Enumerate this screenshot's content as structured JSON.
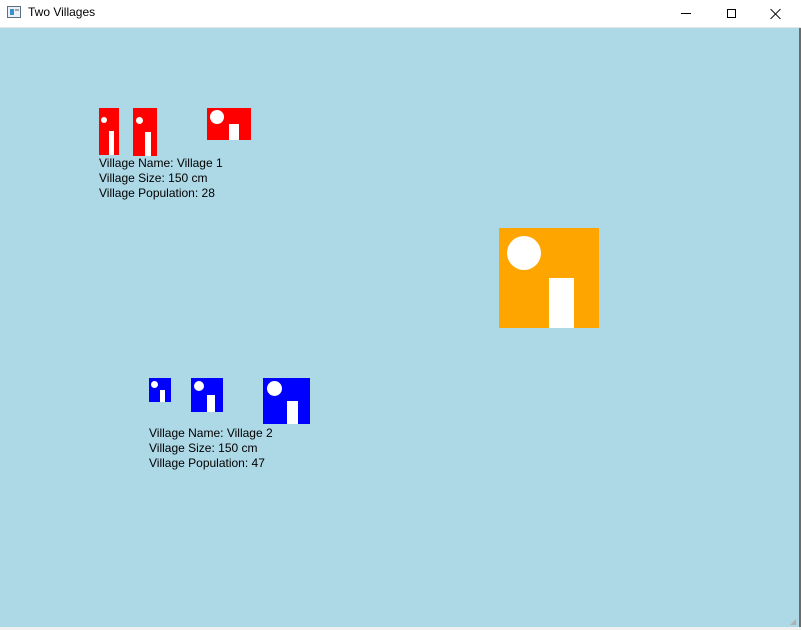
{
  "window": {
    "title": "Two Villages",
    "icon": "app-window-icon"
  },
  "colors": {
    "canvas_bg": "#add8e6",
    "village1_house": "#ff0000",
    "village2_house": "#0000ff",
    "highlight_house": "#ffa500",
    "window_door": "#ffffff"
  },
  "villages": [
    {
      "info": {
        "name_line": "Village Name: Village 1",
        "size_line": "Village Size: 150 cm",
        "population_line": "Village Population: 28"
      },
      "house_count": 3
    },
    {
      "info": {
        "name_line": "Village Name: Village 2",
        "size_line": "Village Size: 150 cm",
        "population_line": "Village Population: 47"
      },
      "house_count": 3
    }
  ],
  "extra_house": {
    "color": "orange"
  }
}
